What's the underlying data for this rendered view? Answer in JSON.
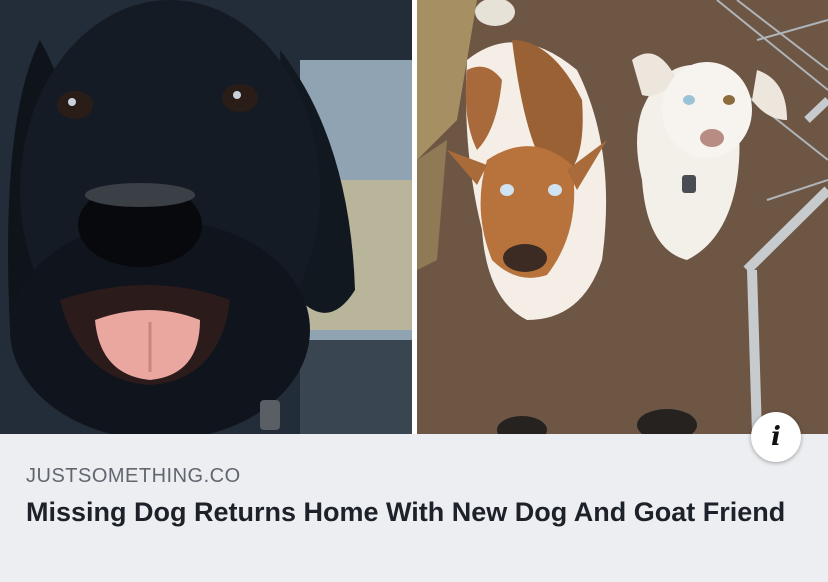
{
  "link_preview": {
    "domain": "JUSTSOMETHING.CO",
    "headline": "Missing Dog Returns Home With New Dog And Goat Friend",
    "info_icon": "info-icon",
    "colors": {
      "caption_background": "#eceef1",
      "domain_text": "#606770",
      "headline_text": "#1d2129"
    }
  },
  "images": {
    "left_photo": "black labrador dog with tongue out in car",
    "right_photo": "brown and white goat beside white dog on dirt ground"
  }
}
